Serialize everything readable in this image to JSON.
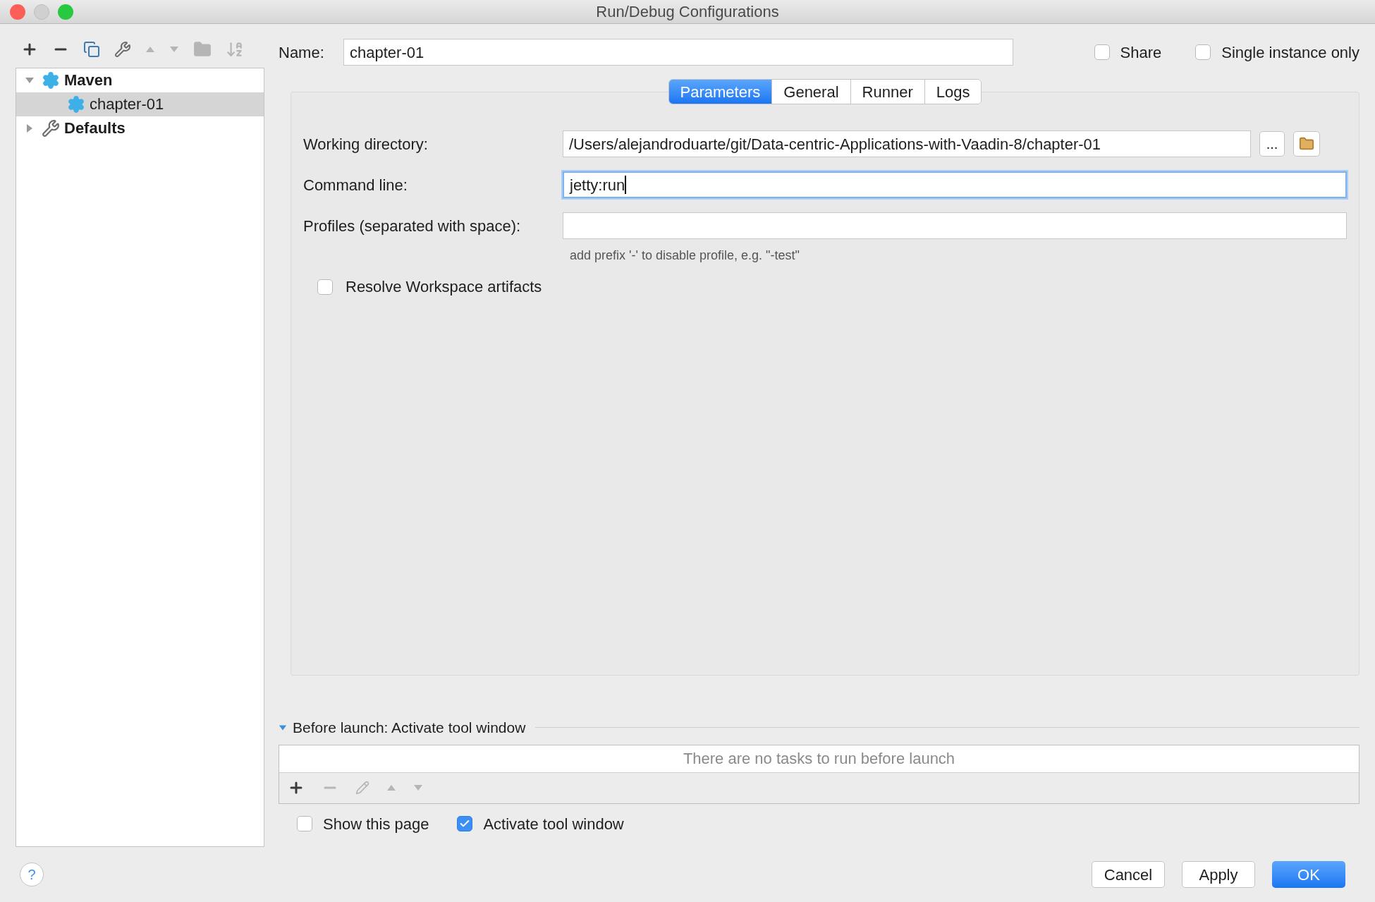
{
  "window": {
    "title": "Run/Debug Configurations"
  },
  "toolbar": [
    {
      "kind": "add",
      "disabled": false
    },
    {
      "kind": "remove",
      "disabled": false
    },
    {
      "kind": "copy",
      "disabled": false
    },
    {
      "kind": "wrench",
      "disabled": false
    },
    {
      "kind": "up",
      "disabled": true
    },
    {
      "kind": "down",
      "disabled": true
    },
    {
      "kind": "folder",
      "disabled": true
    },
    {
      "kind": "sort",
      "disabled": true
    }
  ],
  "tree": [
    {
      "label": "Maven",
      "kind": "maven",
      "expanded": true,
      "selected": false,
      "children": [
        {
          "label": "chapter-01",
          "kind": "maven",
          "selected": true
        }
      ]
    },
    {
      "label": "Defaults",
      "kind": "defaults",
      "expanded": false,
      "selected": false
    }
  ],
  "name": {
    "label": "Name:",
    "value": "chapter-01"
  },
  "options": [
    {
      "label": "Share",
      "checked": false
    },
    {
      "label": "Single instance only",
      "checked": false
    }
  ],
  "tabs": [
    {
      "label": "Parameters",
      "selected": true
    },
    {
      "label": "General",
      "selected": false
    },
    {
      "label": "Runner",
      "selected": false
    },
    {
      "label": "Logs",
      "selected": false
    }
  ],
  "fields": [
    {
      "label": "Working directory:",
      "value": "/Users/alejandroduarte/git/Data-centric-Applications-with-Vaadin-8/chapter-01",
      "focused": false,
      "browse": "..."
    },
    {
      "label": "Command line:",
      "value": "jetty:run",
      "focused": true
    },
    {
      "label": "Profiles (separated with space):",
      "focused": false,
      "hint": "add prefix '-' to disable profile, e.g. \"-test\""
    }
  ],
  "resolve": {
    "label": "Resolve Workspace artifacts",
    "checked": false
  },
  "before_launch": {
    "title": "Before launch: Activate tool window",
    "expanded": true,
    "empty_text": "There are no tasks to run before launch",
    "toolbar": [
      {
        "kind": "add",
        "disabled": false
      },
      {
        "kind": "remove",
        "disabled": true
      },
      {
        "kind": "edit",
        "disabled": true
      },
      {
        "kind": "up",
        "disabled": true
      },
      {
        "kind": "down",
        "disabled": true
      }
    ]
  },
  "bottom_options": [
    {
      "label": "Show this page",
      "checked": false
    },
    {
      "label": "Activate tool window",
      "checked": true
    }
  ],
  "buttons": [
    {
      "label": "Cancel",
      "default": false
    },
    {
      "label": "Apply",
      "default": false
    },
    {
      "label": "OK",
      "default": true
    }
  ],
  "help": "?"
}
